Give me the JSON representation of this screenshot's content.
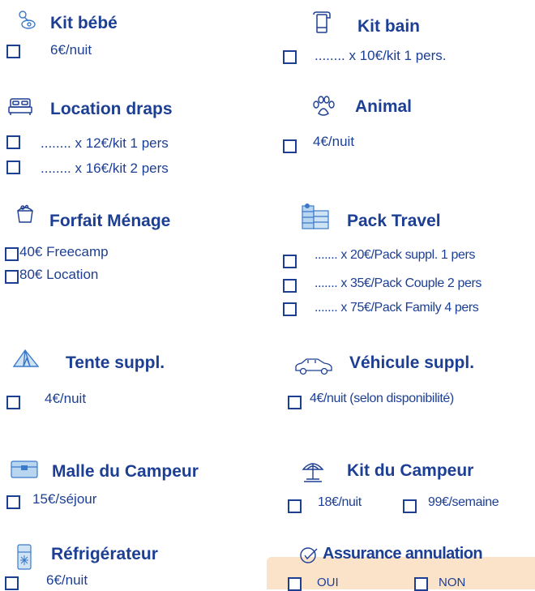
{
  "colors": {
    "text": "#1c3f94",
    "icon": "#3a7ac9",
    "panel": "#fbe3c9"
  },
  "kit_bebe": {
    "icon": "pacifier-icon",
    "title": "Kit bébé",
    "line1": "6€/nuit"
  },
  "kit_bain": {
    "icon": "towel-icon",
    "title": "Kit bain",
    "line1": "........ x 10€/kit 1 pers."
  },
  "location_draps": {
    "icon": "bed-icon",
    "title": "Location draps",
    "line1": "........ x 12€/kit 1 pers",
    "line2": "........ x 16€/kit 2 pers"
  },
  "animal": {
    "icon": "paw-icon",
    "title": "Animal",
    "line1": "4€/nuit"
  },
  "forfait_menage": {
    "icon": "cleaning-bucket-icon",
    "title": "Forfait Ménage",
    "line1": "40€ Freecamp",
    "line2": "80€ Location"
  },
  "pack_travel": {
    "icon": "laundry-pack-icon",
    "title": "Pack Travel",
    "line1": "....... x 20€/Pack suppl. 1 pers",
    "line2": "....... x 35€/Pack Couple 2 pers",
    "line3": "....... x 75€/Pack Family 4 pers"
  },
  "tente": {
    "icon": "tent-icon",
    "title": "Tente suppl.",
    "line1": "4€/nuit"
  },
  "vehicule": {
    "icon": "car-icon",
    "title": "Véhicule suppl.",
    "line1": "4€/nuit (selon disponibilité)"
  },
  "malle": {
    "icon": "trunk-icon",
    "title": "Malle du Campeur",
    "line1": "15€/séjour"
  },
  "kit_campeur": {
    "icon": "parasol-icon",
    "title": "Kit du Campeur",
    "line1": "18€/nuit",
    "line2": "99€/semaine"
  },
  "refrigerateur": {
    "icon": "fridge-icon",
    "title": "Réfrigérateur",
    "line1": "6€/nuit"
  },
  "assurance": {
    "icon": "check-circle-icon",
    "title": "Assurance annulation",
    "oui": "OUI",
    "non": "NON"
  }
}
